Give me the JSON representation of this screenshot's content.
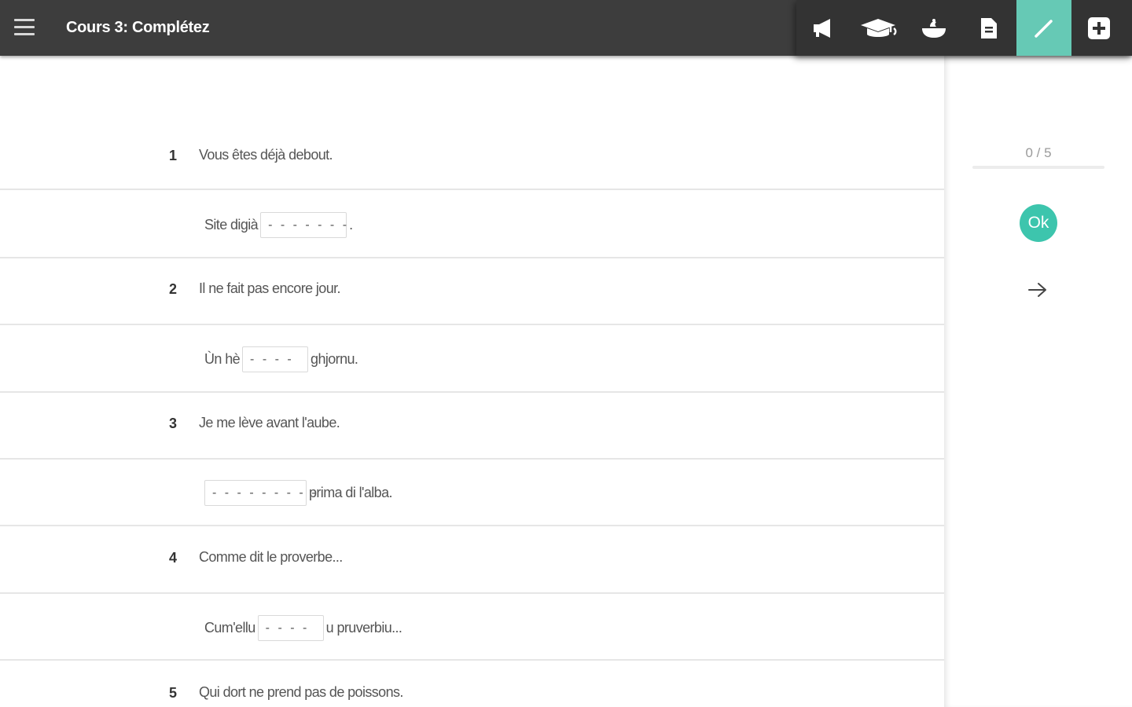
{
  "header": {
    "title": "Cours 3: Complétez",
    "menu_icon": "hamburger-menu-icon",
    "tools": [
      {
        "name": "audio",
        "icon": "megaphone-icon",
        "active": false
      },
      {
        "name": "lesson",
        "icon": "graduation-cap-icon",
        "active": false
      },
      {
        "name": "culture",
        "icon": "dish-icon",
        "active": false
      },
      {
        "name": "document",
        "icon": "document-icon",
        "active": false
      },
      {
        "name": "exercise",
        "icon": "pencil-icon",
        "active": true
      },
      {
        "name": "add",
        "icon": "plus-box-icon",
        "active": false
      }
    ],
    "active_color": "#66c9b5"
  },
  "exercise": {
    "items": [
      {
        "number": "1",
        "prompt": "Vous êtes déjà debout.",
        "answer_before": "Site digià",
        "blank": "- - - - - - -",
        "answer_after": "."
      },
      {
        "number": "2",
        "prompt": "Il ne fait pas encore jour.",
        "answer_before": "Ùn hè",
        "blank": "- - - -",
        "answer_after": "ghjornu."
      },
      {
        "number": "3",
        "prompt": "Je me lève avant l'aube.",
        "answer_before": "",
        "blank": "- - - - - - - - -",
        "answer_after": "prima di l'alba."
      },
      {
        "number": "4",
        "prompt": "Comme dit le proverbe...",
        "answer_before": "Cum'ellu",
        "blank": "- - - -",
        "answer_after": "u pruverbiu..."
      },
      {
        "number": "5",
        "prompt": "Qui dort ne prend pas de poissons."
      }
    ]
  },
  "sidebar": {
    "score": "0 / 5",
    "ok_label": "Ok",
    "ok_color": "#3dc5ad",
    "next_icon": "arrow-right-icon"
  }
}
